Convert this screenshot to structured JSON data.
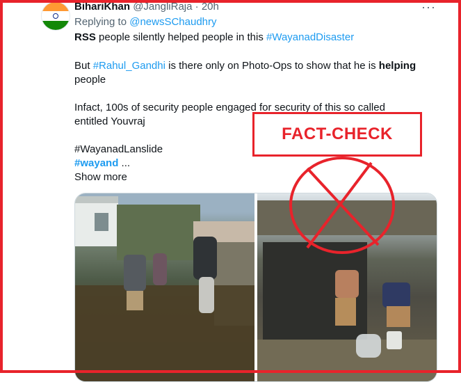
{
  "tweet": {
    "display_name": "BihariKhan",
    "handle": "@JangliRaja",
    "separator": "·",
    "time": "20h",
    "more_label": "···",
    "replying_prefix": "Replying to",
    "replying_handle": "@newsSChaudhry",
    "line1_bold": "RSS",
    "line1_text": " people silently helped people in this ",
    "line1_tag": "#WayanadDisaster",
    "line2_prefix": "But ",
    "line2_tag": "#Rahul_Gandhi",
    "line2_text": " is there only on Photo-Ops to show that he is ",
    "line2_bold": "helping",
    "line3": "people",
    "line4": "Infact, 100s of security people engaged for security of this so called",
    "line5": "entitled Youvraj",
    "tag1": "#WayanadLanslide",
    "tag2": "#wayand",
    "ellipsis": " ...",
    "show_more": "Show more"
  },
  "overlay": {
    "fact_check": "FACT-CHECK"
  },
  "colors": {
    "accent_red": "#e8232b",
    "link_blue": "#1d9bf0",
    "muted_gray": "#536471"
  },
  "icons": {
    "avatar": "indian-flag-avatar",
    "more": "more-options-icon",
    "cross": "cross-circle-icon"
  }
}
